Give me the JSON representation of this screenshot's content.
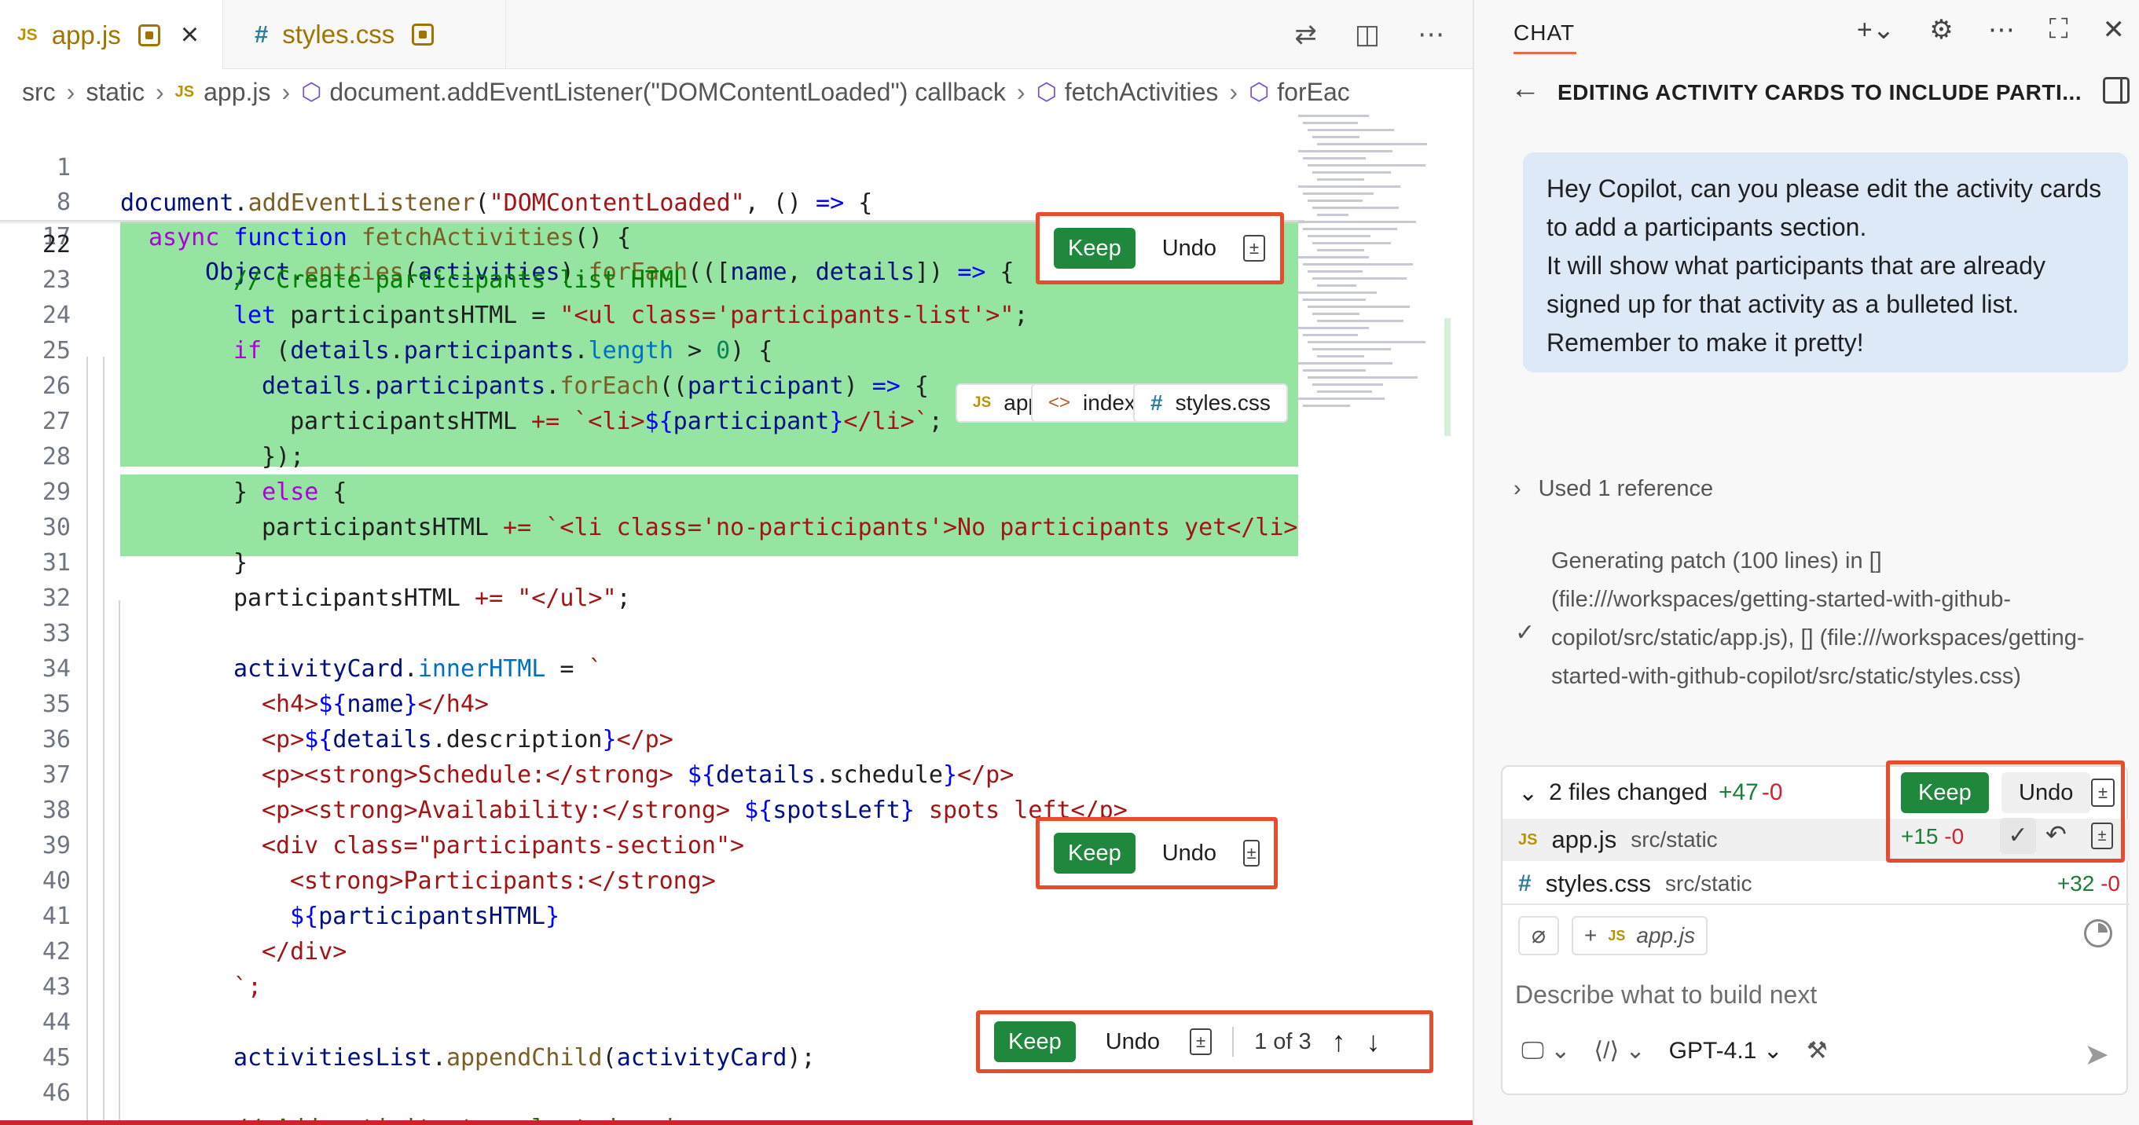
{
  "tabs": [
    {
      "icon": "JS",
      "label": "app.js"
    },
    {
      "icon": "#",
      "label": "styles.css"
    }
  ],
  "breadcrumb": {
    "src": "src",
    "static": "static",
    "file": "app.js",
    "callback": "document.addEventListener(\"DOMContentLoaded\") callback",
    "fn": "fetchActivities",
    "trail": "forEac"
  },
  "gutter": {
    "l1": "1",
    "l8": "8",
    "l17": "17",
    "l22": "22",
    "l23": "23",
    "l24": "24",
    "l25": "25",
    "l26": "26",
    "l27": "27",
    "l28": "28",
    "l29": "29",
    "l30": "30",
    "l31": "31",
    "l32": "32",
    "l33": "33",
    "l34": "34",
    "l35": "35",
    "l36": "36",
    "l37": "37",
    "l38": "38",
    "l39": "39",
    "l40": "40",
    "l41": "41",
    "l42": "42",
    "l43": "43",
    "l44": "44",
    "l45": "45",
    "l46": "46"
  },
  "code": {
    "l1": [
      "document",
      ".",
      "addEventListener",
      "(",
      "\"DOMContentLoaded\"",
      ", () ",
      "=>",
      " {"
    ],
    "l8": [
      "async",
      " ",
      "function",
      " ",
      "fetchActivities",
      "() {"
    ],
    "l17": [
      "Object",
      ".",
      "entries",
      "(",
      "activities",
      ").",
      "forEach",
      "(([",
      "name",
      ", ",
      "details",
      "]) ",
      "=>",
      " {"
    ],
    "l23": "// Create participants list HTML",
    "l24": [
      "let",
      " participantsHTML = ",
      "\"<ul class='participants-list'>\"",
      ";"
    ],
    "l25": [
      "if",
      " (",
      "details",
      ".",
      "participants",
      ".",
      "length",
      " > ",
      "0",
      ") {"
    ],
    "l26": [
      "details",
      ".",
      "participants",
      ".",
      "forEach",
      "((",
      "participant",
      ") ",
      "=>",
      " {"
    ],
    "l27": [
      "participantsHTML ",
      "+=",
      " `<li>",
      "${",
      "participant",
      "}",
      "</li>`",
      ";"
    ],
    "l28": "});",
    "l29": [
      "}",
      " else",
      " {"
    ],
    "l30": [
      "participantsHTML ",
      "+=",
      " `<li class='no-participants'>No participants yet</li>"
    ],
    "l31": "}",
    "l32": [
      "participantsHTML ",
      "+=",
      " \"</ul>\"",
      ";"
    ],
    "l34": [
      "activityCard",
      ".",
      "innerHTML",
      " = ",
      "`"
    ],
    "l35": [
      "<h4>",
      "${",
      "name",
      "}",
      "</h4>"
    ],
    "l36": [
      "<p>",
      "${",
      "details",
      ".description",
      "}",
      "</p>"
    ],
    "l37": [
      "<p><strong>Schedule:</strong> ",
      "${",
      "details",
      ".schedule",
      "}",
      "</p>"
    ],
    "l38": [
      "<p><strong>Availability:</strong> ",
      "${",
      "spotsLeft",
      "}",
      " spots left</p>"
    ],
    "l39": "<div class=\"participants-section\">",
    "l40": "<strong>Participants:</strong>",
    "l41": [
      "${",
      "participantsHTML",
      "}"
    ],
    "l42": "</div>",
    "l43": "`;",
    "l45": [
      "activitiesList",
      ".",
      "appendChild",
      "(",
      "activityCard",
      ");"
    ],
    "l46": "// Add activity to select dropdown"
  },
  "inline_actions": {
    "keep": "Keep",
    "undo": "Undo",
    "counter": "1 of 3"
  },
  "chat": {
    "title": "CHAT",
    "session_title": "EDITING ACTIVITY CARDS TO INCLUDE PARTI...",
    "user_message": "Hey Copilot, can you please edit the activity cards to add a participants section.\nIt will show what participants that are already signed up for that activity as a bulleted list. Remember to make it pretty!",
    "attachments": [
      {
        "icon": "JS",
        "label": "app.js"
      },
      {
        "icon": "<>",
        "label": "index.html"
      },
      {
        "icon": "#",
        "label": "styles.css"
      }
    ],
    "references": "Used 1 reference",
    "patch_message": "Generating patch (100 lines) in [] (file:///workspaces/getting-started-with-github-copilot/src/static/app.js), [] (file:///workspaces/getting-started-with-github-copilot/src/static/styles.css)",
    "changes": {
      "summary": "2 files changed",
      "added": "+47",
      "removed": "-0",
      "keep": "Keep",
      "undo": "Undo",
      "files": [
        {
          "icon": "JS",
          "name": "app.js",
          "path": "src/static",
          "added": "+15",
          "removed": "-0"
        },
        {
          "icon": "#",
          "name": "styles.css",
          "path": "src/static",
          "added": "+32",
          "removed": "-0"
        }
      ]
    },
    "context_chip": "app.js",
    "input_placeholder": "Describe what to build next",
    "model": "GPT-4.1"
  }
}
